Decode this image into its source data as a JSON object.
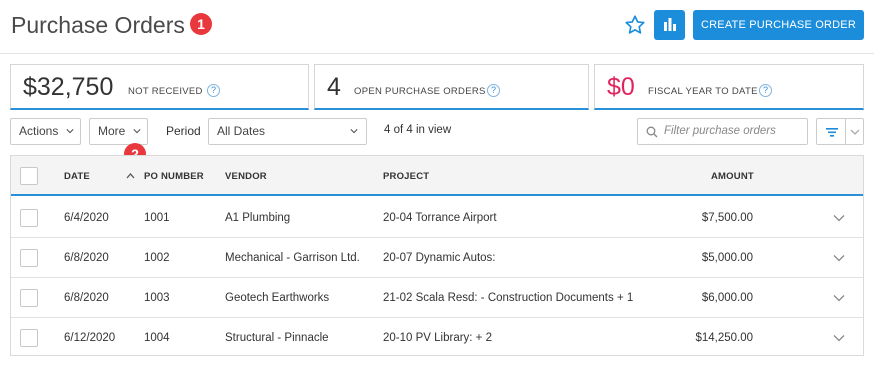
{
  "header": {
    "title": "Purchase Orders",
    "badge_1": "1",
    "create_label": "CREATE PURCHASE ORDER"
  },
  "stats": [
    {
      "value": "$32,750",
      "label": "NOT RECEIVED",
      "help": "?"
    },
    {
      "value": "4",
      "label": "OPEN PURCHASE ORDERS",
      "help": "?"
    },
    {
      "value": "$0",
      "label": "FISCAL YEAR TO DATE",
      "help": "?"
    }
  ],
  "toolbar": {
    "actions_label": "Actions",
    "more_label": "More",
    "badge_2": "2",
    "period_label": "Period",
    "period_value": "All Dates",
    "view_count": "4 of 4 in view",
    "filter_placeholder": "Filter purchase orders"
  },
  "table": {
    "columns": {
      "date": "DATE",
      "po_number": "PO NUMBER",
      "vendor": "VENDOR",
      "project": "PROJECT",
      "amount": "AMOUNT"
    },
    "rows": [
      {
        "date": "6/4/2020",
        "po": "1001",
        "vendor": "A1 Plumbing",
        "project": "20-04 Torrance Airport",
        "amount": "$7,500.00"
      },
      {
        "date": "6/8/2020",
        "po": "1002",
        "vendor": "Mechanical - Garrison Ltd.",
        "project": "20-07 Dynamic Autos:",
        "amount": "$5,000.00"
      },
      {
        "date": "6/8/2020",
        "po": "1003",
        "vendor": "Geotech Earthworks",
        "project": "21-02 Scala Resd: - Construction Documents + 1",
        "amount": "$6,000.00"
      },
      {
        "date": "6/12/2020",
        "po": "1004",
        "vendor": "Structural - Pinnacle",
        "project": "20-10 PV Library: + 2",
        "amount": "$14,250.00"
      }
    ]
  },
  "colors": {
    "accent": "#1c8ddb",
    "badge": "#e8383d",
    "negative_value": "#e0245e"
  },
  "icons": [
    "star-icon",
    "bar-chart-icon",
    "help-icon",
    "chevron-down-icon",
    "search-icon",
    "filter-icon",
    "sort-asc-icon"
  ]
}
